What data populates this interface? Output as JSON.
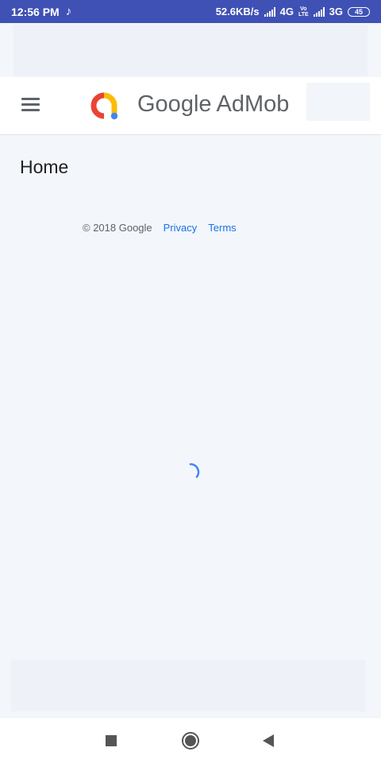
{
  "status_bar": {
    "time": "12:56 PM",
    "speed": "52.6KB/s",
    "network1": "4G",
    "volte_top": "Vo",
    "volte_bottom": "LTE",
    "network2": "3G",
    "battery": "45",
    "icons": [
      "tiktok-icon",
      "signal-icon",
      "signal-icon"
    ]
  },
  "header": {
    "brand_google": "Google",
    "brand_product": "AdMob",
    "logo_colors": {
      "red": "#ea4335",
      "yellow": "#fbbc04",
      "blue": "#4285f4"
    }
  },
  "main": {
    "title": "Home",
    "footer": {
      "copyright": "© 2018 Google",
      "privacy": "Privacy",
      "terms": "Terms"
    }
  },
  "colors": {
    "status_bar": "#3f51b5",
    "background": "#f3f6fa",
    "link": "#1a73e8",
    "spinner": "#4285f4"
  },
  "nav": {
    "icons": [
      "recents-icon",
      "home-icon",
      "back-icon"
    ]
  }
}
